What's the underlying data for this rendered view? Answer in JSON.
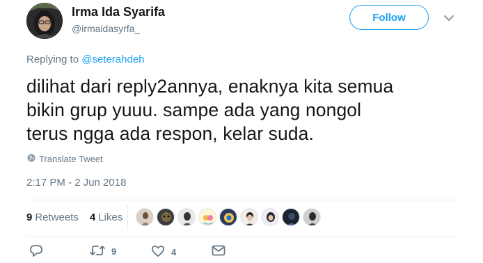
{
  "author": {
    "name": "Irma Ida Syarifa",
    "handle": "@irmaidasyrfa_"
  },
  "follow_label": "Follow",
  "replying": {
    "prefix": "Replying to ",
    "to": "@seterahdeh"
  },
  "tweet": {
    "lines": [
      "dilihat dari reply2annya, enaknya kita semua",
      "bikin grup yuuu. sampe ada yang nongol",
      "terus ngga ada respon, kelar suda."
    ]
  },
  "translate_label": "Translate Tweet",
  "timestamp": "2:17 PM - 2 Jun 2018",
  "stats": {
    "retweets_count": "9",
    "retweets_label": "Retweets",
    "likes_count": "4",
    "likes_label": "Likes"
  },
  "actions": {
    "retweet_count": "9",
    "like_count": "4"
  },
  "colors": {
    "accent": "#1da1f2",
    "secondary_text": "#657786",
    "primary_text": "#14171a"
  },
  "icons": [
    "chevron-down-icon",
    "globe-icon",
    "reply-icon",
    "retweet-icon",
    "heart-icon",
    "message-icon"
  ]
}
